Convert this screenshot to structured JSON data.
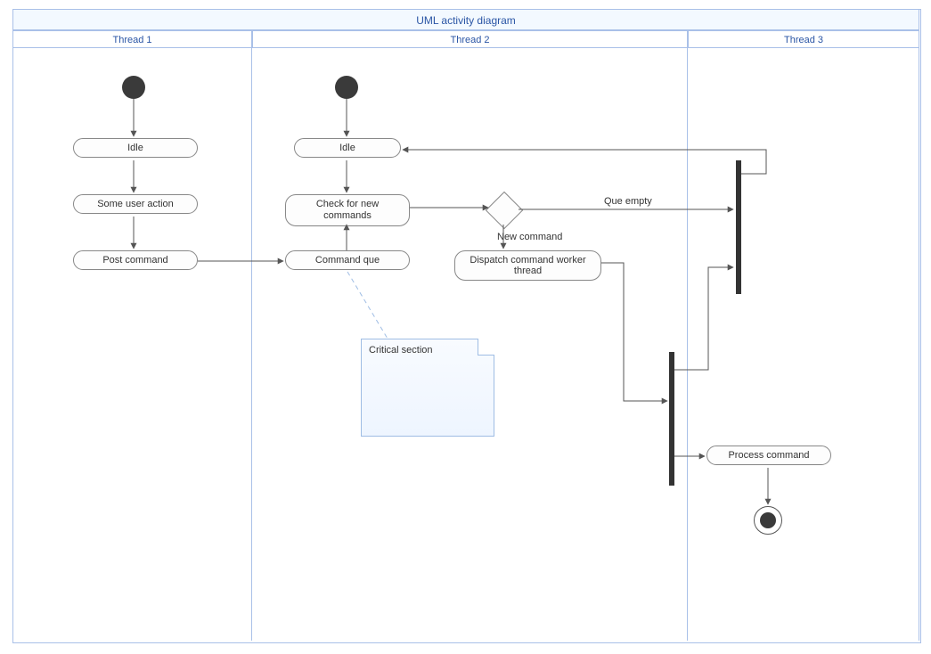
{
  "diagram": {
    "title": "UML activity diagram",
    "lanes": [
      "Thread 1",
      "Thread 2",
      "Thread 3"
    ]
  },
  "activities": {
    "t1_idle": "Idle",
    "t1_user_action": "Some user action",
    "t1_post_command": "Post command",
    "t2_idle": "Idle",
    "t2_check_commands": "Check for new commands",
    "t2_command_que": "Command que",
    "t2_dispatch": "Dispatch command worker thread",
    "t3_process": "Process command"
  },
  "labels": {
    "que_empty": "Que empty",
    "new_command": "New command"
  },
  "note": {
    "text": "Critical section"
  }
}
